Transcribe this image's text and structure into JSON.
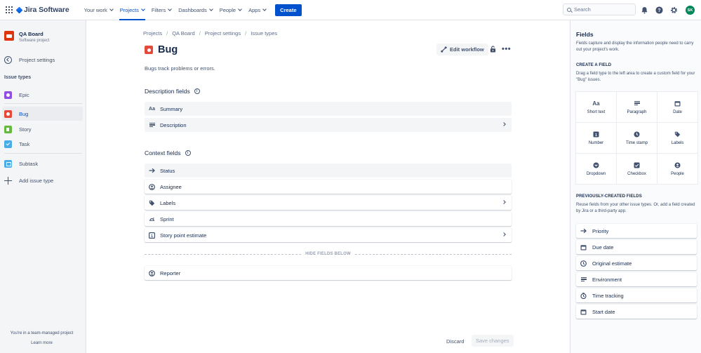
{
  "topnav": {
    "app_name": "Jira Software",
    "items": [
      {
        "label": "Your work",
        "active": false
      },
      {
        "label": "Projects",
        "active": true
      },
      {
        "label": "Filters",
        "active": false
      },
      {
        "label": "Dashboards",
        "active": false
      },
      {
        "label": "People",
        "active": false
      },
      {
        "label": "Apps",
        "active": false
      }
    ],
    "create_label": "Create",
    "search_placeholder": "Search",
    "avatar_initials": "SK"
  },
  "sidebar": {
    "project_name": "QA Board",
    "project_type": "Software project",
    "project_settings": "Project settings",
    "section_label": "Issue types",
    "items": [
      {
        "label": "Epic"
      },
      {
        "label": "Bug"
      },
      {
        "label": "Story"
      },
      {
        "label": "Task"
      },
      {
        "label": "Subtask"
      }
    ],
    "add_issue_type": "Add issue type",
    "footer_text": "You're in a team-managed project",
    "learn_more": "Learn more"
  },
  "main": {
    "breadcrumbs": [
      "Projects",
      "QA Board",
      "Project settings",
      "Issue types"
    ],
    "title": "Bug",
    "edit_workflow": "Edit workflow",
    "description": "Bugs track problems or errors.",
    "description_fields_title": "Description fields",
    "description_fields": [
      {
        "label": "Summary",
        "icon": "summary-icon"
      },
      {
        "label": "Description",
        "icon": "description-icon"
      }
    ],
    "context_fields_title": "Context fields",
    "context_fields": [
      {
        "label": "Status",
        "icon": "status-icon"
      },
      {
        "label": "Assignee",
        "icon": "assignee-icon"
      },
      {
        "label": "Labels",
        "icon": "labels-icon"
      },
      {
        "label": "Sprint",
        "icon": "sprint-icon"
      },
      {
        "label": "Story point estimate",
        "icon": "story-point-icon"
      }
    ],
    "hide_fields_label": "HIDE FIELDS BELOW",
    "hidden_fields": [
      {
        "label": "Reporter",
        "icon": "reporter-icon"
      }
    ],
    "discard_label": "Discard",
    "save_label": "Save changes"
  },
  "panel": {
    "title": "Fields",
    "intro": "Fields capture and display the information people need to carry out your project's work.",
    "create_heading": "CREATE A FIELD",
    "create_text": "Drag a field type to the left area to create a custom field for your \"Bug\" issues.",
    "field_types": [
      {
        "label": "Short text",
        "icon": "short-text-icon"
      },
      {
        "label": "Paragraph",
        "icon": "paragraph-icon"
      },
      {
        "label": "Date",
        "icon": "date-icon"
      },
      {
        "label": "Number",
        "icon": "number-icon"
      },
      {
        "label": "Time stamp",
        "icon": "time-stamp-icon"
      },
      {
        "label": "Labels",
        "icon": "labels-icon"
      },
      {
        "label": "Dropdown",
        "icon": "dropdown-icon"
      },
      {
        "label": "Checkbox",
        "icon": "checkbox-icon"
      },
      {
        "label": "People",
        "icon": "people-icon"
      }
    ],
    "previous_heading": "PREVIOUSLY-CREATED FIELDS",
    "previous_text": "Reuse fields from your other issue types. Or, add a field created by Jira or a third-party app.",
    "previous_fields": [
      {
        "label": "Priority",
        "icon": "priority-icon"
      },
      {
        "label": "Due date",
        "icon": "due-date-icon"
      },
      {
        "label": "Original estimate",
        "icon": "original-estimate-icon"
      },
      {
        "label": "Environment",
        "icon": "environment-icon"
      },
      {
        "label": "Time tracking",
        "icon": "time-tracking-icon"
      },
      {
        "label": "Start date",
        "icon": "start-date-icon"
      }
    ]
  },
  "colors": {
    "accent": "#0052cc",
    "bug": "#e5493a",
    "story": "#63ba3c",
    "epic": "#904ee2",
    "task": "#4bade8"
  }
}
